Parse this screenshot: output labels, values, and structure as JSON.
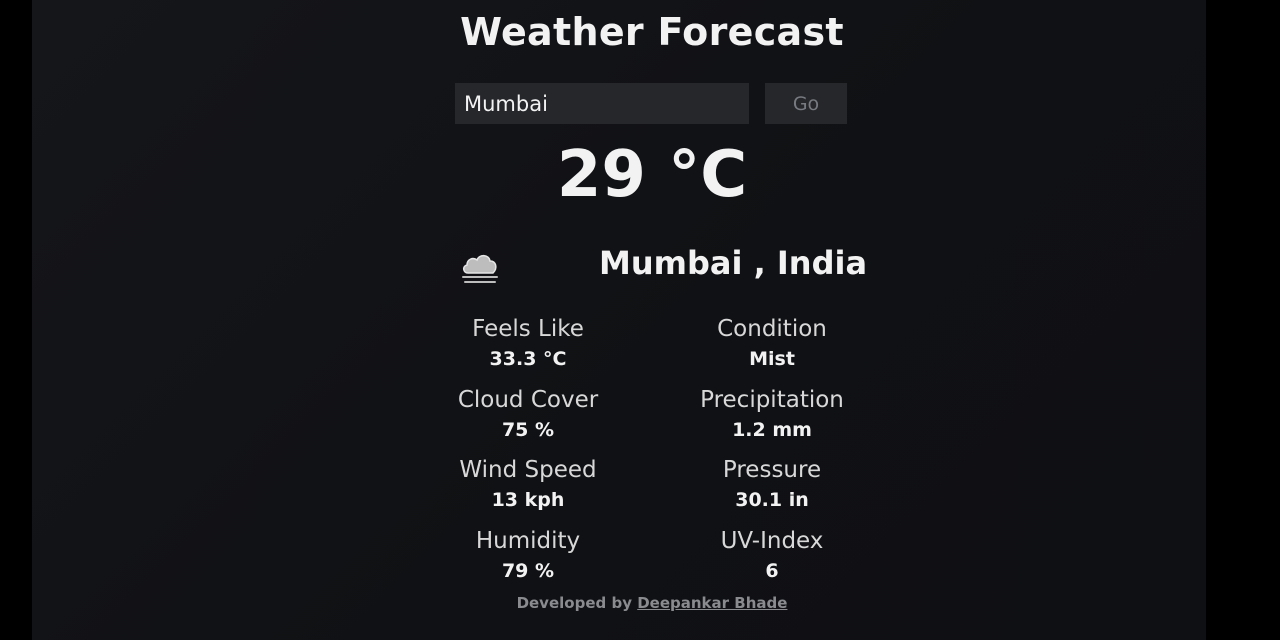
{
  "header": {
    "title": "Weather Forecast"
  },
  "search": {
    "value": "Mumbai",
    "button_label": "Go"
  },
  "current": {
    "temperature": "29 °C",
    "location": "Mumbai , India",
    "icon": "cloud-mist-icon"
  },
  "stats": [
    {
      "label": "Feels Like",
      "value": "33.3 °C"
    },
    {
      "label": "Condition",
      "value": "Mist"
    },
    {
      "label": "Cloud Cover",
      "value": "75 %"
    },
    {
      "label": "Precipitation",
      "value": "1.2 mm"
    },
    {
      "label": "Wind Speed",
      "value": "13 kph"
    },
    {
      "label": "Pressure",
      "value": "30.1 in"
    },
    {
      "label": "Humidity",
      "value": "79 %"
    },
    {
      "label": "UV-Index",
      "value": "6"
    }
  ],
  "footer": {
    "prefix": "Developed by",
    "author": "Deepankar Bhade"
  }
}
